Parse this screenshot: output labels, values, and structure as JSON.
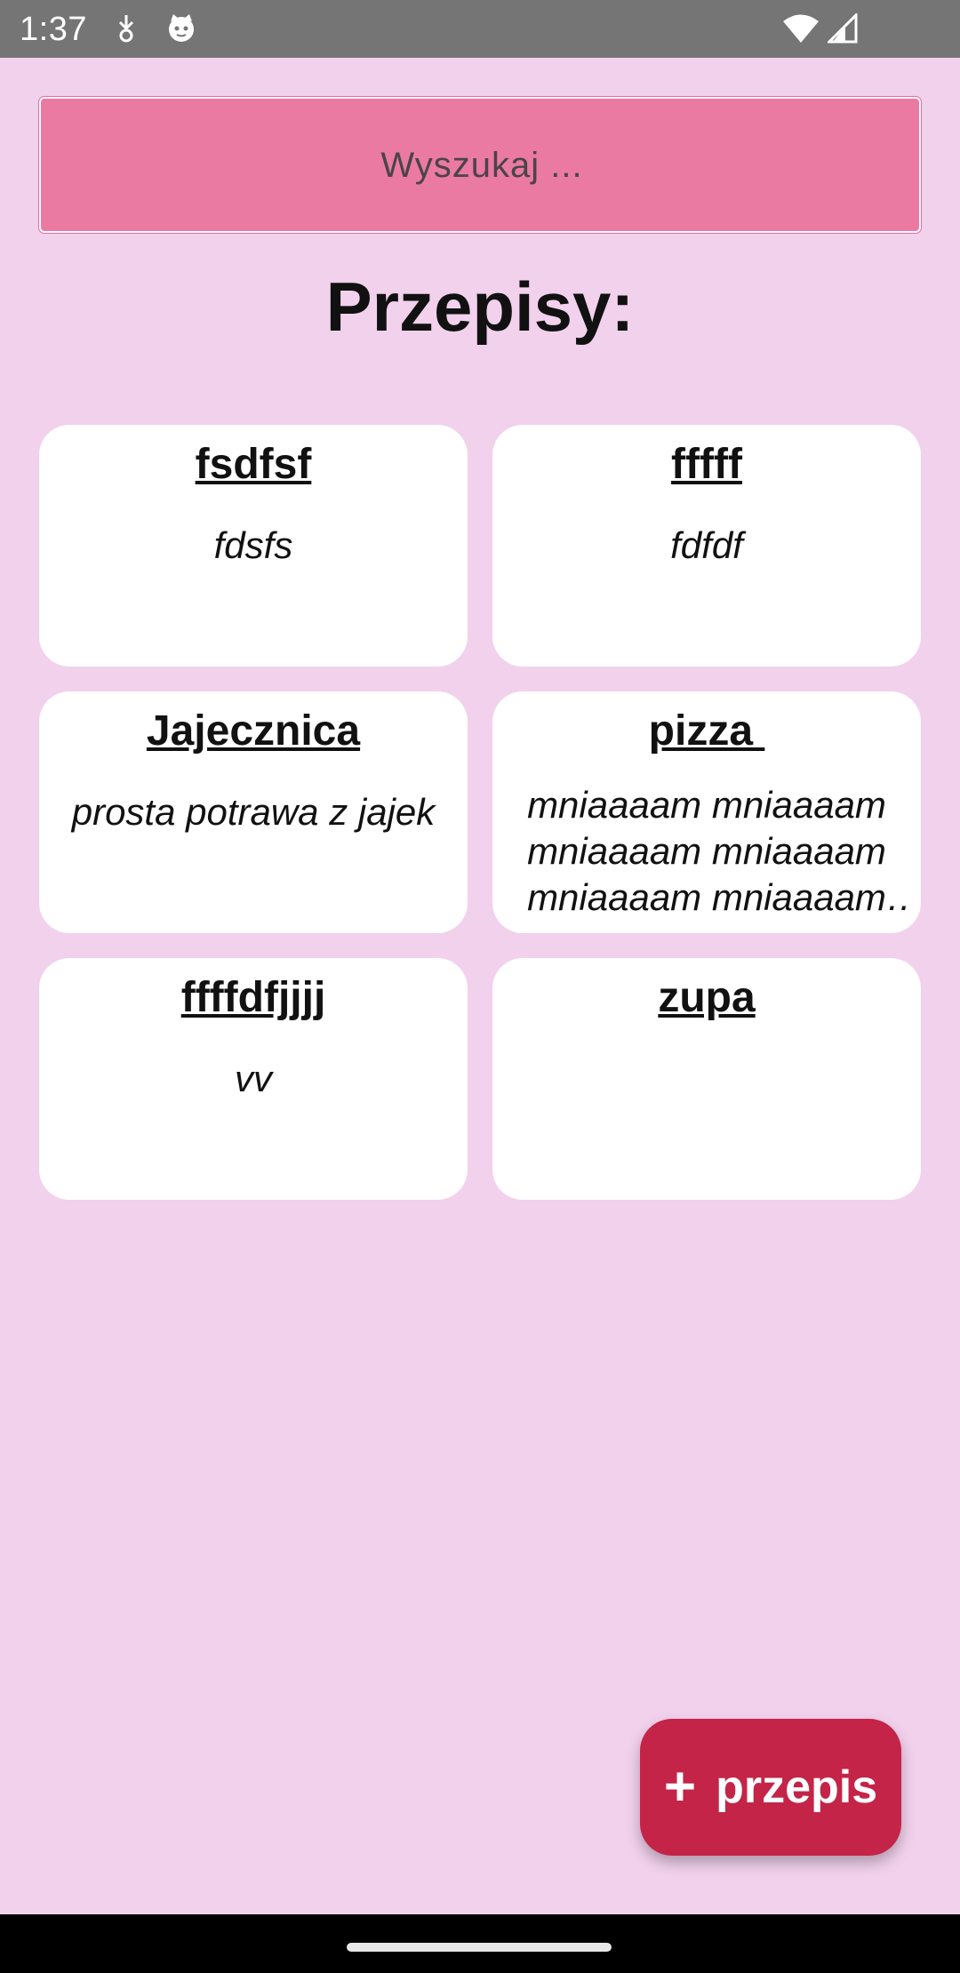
{
  "status_bar": {
    "time": "1:37",
    "icons_left": [
      "download-icon",
      "cat-face-icon"
    ],
    "icons_right": [
      "wifi-icon",
      "cell-signal-icon"
    ]
  },
  "search": {
    "placeholder": "Wyszukaj ...",
    "value": ""
  },
  "main": {
    "title": "Przepisy:"
  },
  "recipes": [
    {
      "title": "fsdfsf",
      "description": "fdsfs"
    },
    {
      "title": "fffff",
      "description": "fdfdf"
    },
    {
      "title": "Jajecznica",
      "description": "prosta potrawa z jajek"
    },
    {
      "title": "pizza ",
      "description": "mniaaaam mniaaaam mniaaaam mniaaaam mniaaaam mniaaaam …"
    },
    {
      "title": "ffffdfjjjj",
      "description": "vv"
    },
    {
      "title": "zupa",
      "description": ""
    }
  ],
  "fab": {
    "icon": "plus-icon",
    "icon_glyph": "+",
    "label": "przepis"
  },
  "colors": {
    "background": "#f2d1ed",
    "search_bg": "#eb7aa3",
    "fab_bg": "#c42447",
    "status_bar": "#757575"
  }
}
